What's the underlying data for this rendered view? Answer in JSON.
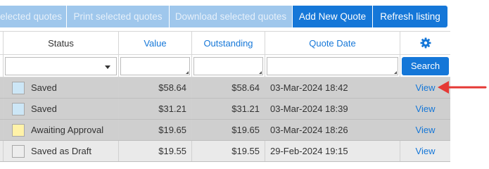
{
  "toolbar": {
    "buttons": [
      {
        "label": "elected quotes",
        "state": "disabled"
      },
      {
        "label": "Print selected quotes",
        "state": "disabled"
      },
      {
        "label": "Download selected quotes",
        "state": "disabled"
      },
      {
        "label": "Add New Quote",
        "state": "primary"
      },
      {
        "label": "Refresh listing",
        "state": "primary"
      }
    ]
  },
  "grid": {
    "headers": {
      "status": "Status",
      "value": "Value",
      "outstanding": "Outstanding",
      "quote_date": "Quote Date",
      "settings_icon": "gear-icon"
    },
    "filters": {
      "search_label": "Search"
    },
    "rows": [
      {
        "status": "Saved",
        "swatch": "#cce6f6",
        "value": "$58.64",
        "outstanding": "$58.64",
        "date": "03-Mar-2024 18:42",
        "action": "View"
      },
      {
        "status": "Saved",
        "swatch": "#cce6f6",
        "value": "$31.21",
        "outstanding": "$31.21",
        "date": "03-Mar-2024 18:39",
        "action": "View"
      },
      {
        "status": "Awaiting Approval",
        "swatch": "#fff2a8",
        "value": "$19.65",
        "outstanding": "$19.65",
        "date": "03-Mar-2024 18:26",
        "action": "View"
      },
      {
        "status": "Saved as Draft",
        "swatch": "#ededed",
        "value": "$19.55",
        "outstanding": "$19.55",
        "date": "29-Feb-2024 19:15",
        "action": "View"
      }
    ]
  },
  "colors": {
    "accent": "#1577d8",
    "disabled": "#9fc7ec",
    "annotation_arrow": "#e53935"
  }
}
